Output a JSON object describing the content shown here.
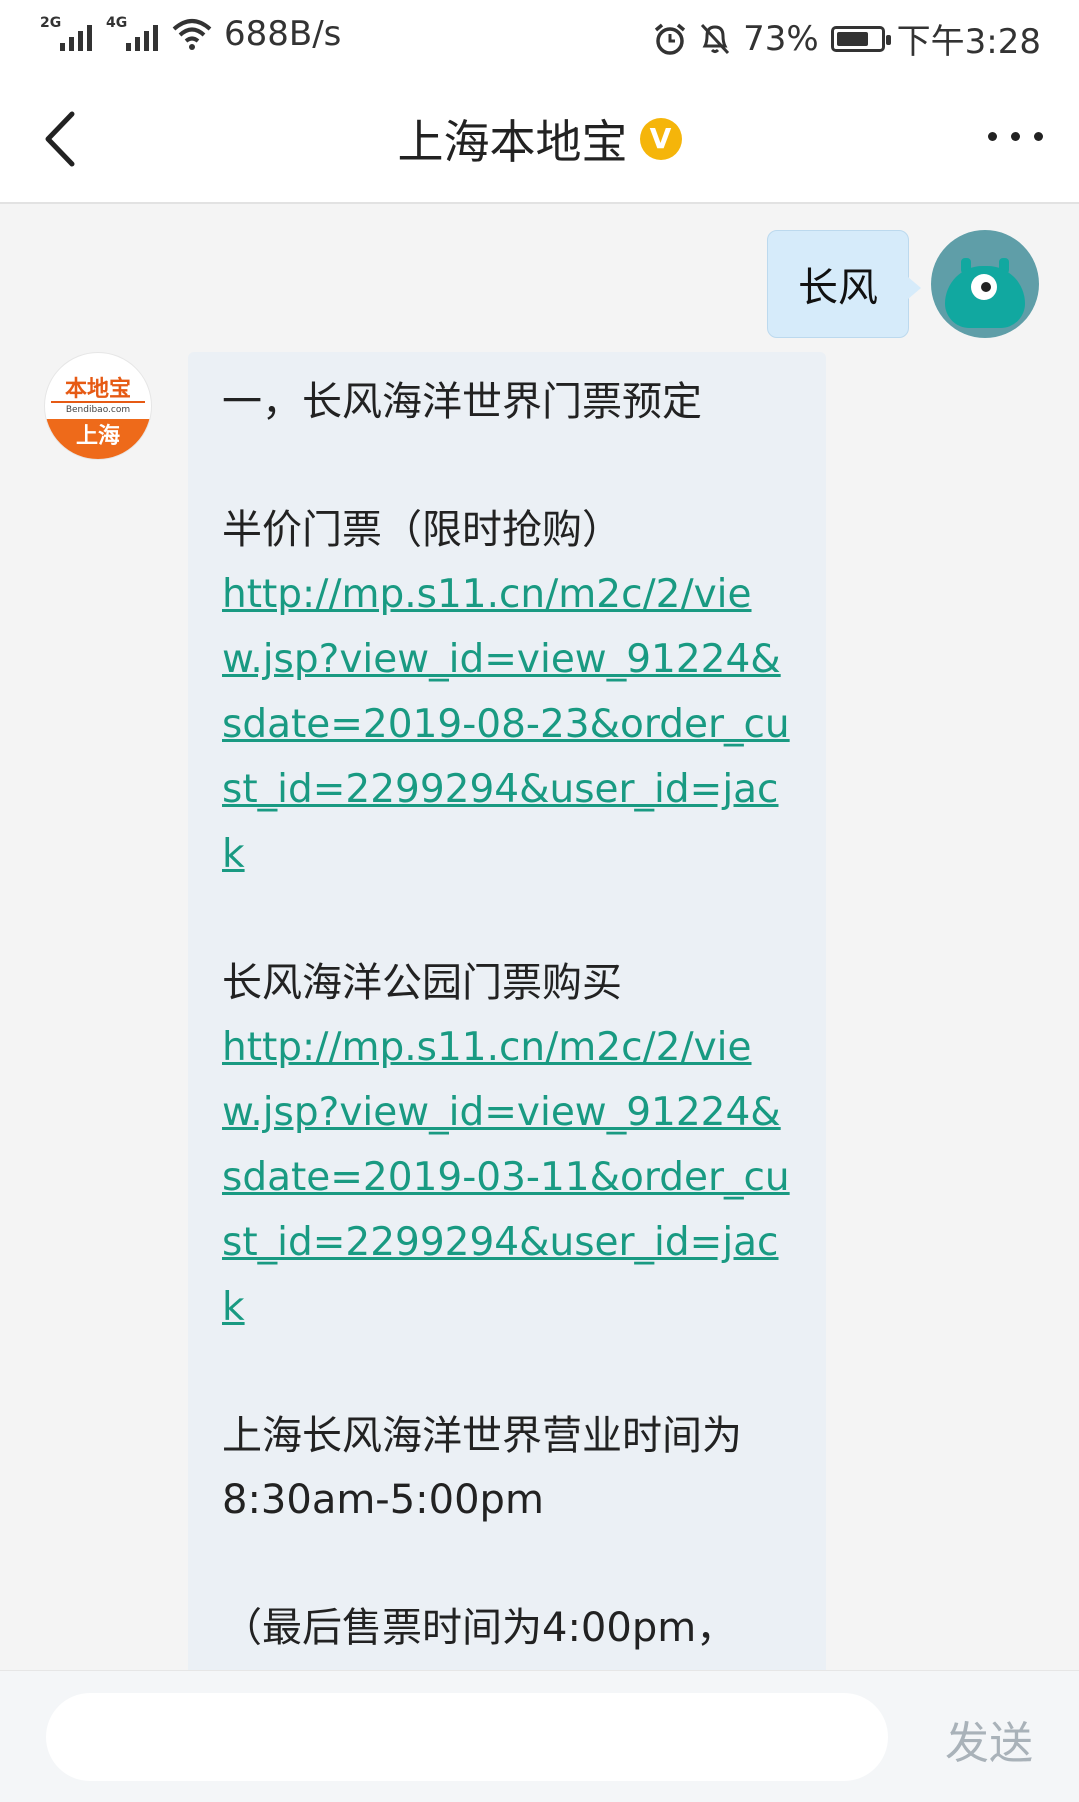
{
  "status_bar": {
    "net1": "2G",
    "net2": "4G",
    "speed": "688B/s",
    "battery_pct": "73%",
    "battery_level": 0.73,
    "time": "下午3:28"
  },
  "header": {
    "title": "上海本地宝",
    "verified_badge": "V",
    "back_icon": "chevron-left-icon",
    "more_icon": "more-dots-icon"
  },
  "messages": [
    {
      "side": "right",
      "text": "长风"
    },
    {
      "side": "left",
      "avatar": {
        "top": "本地宝",
        "mid": "Bendibao.com",
        "bottom": "上海"
      },
      "lines": {
        "l1": "一，长风海洋世界门票预定",
        "l2": "半价门票（限时抢购）",
        "link1": "http://mp.s11.cn/m2c/2/view.jsp?view_id=view_91224&sdate=2019-08-23&order_cust_id=2299294&user_id=jack",
        "l3": "长风海洋公园门票购买",
        "link2": "http://mp.s11.cn/m2c/2/view.jsp?view_id=view_91224&sdate=2019-03-11&order_cust_id=2299294&user_id=jack",
        "l4": "上海长风海洋世界营业时间为8:30am-5:00pm",
        "l5": "（最后售票时间为4:00pm，"
      }
    }
  ],
  "input": {
    "placeholder": "",
    "send_label": "发送"
  },
  "colors": {
    "link": "#199a82",
    "user_bubble": "#d6ebfa",
    "bot_bubble": "#ebf0f5",
    "badge": "#f5b50a"
  }
}
